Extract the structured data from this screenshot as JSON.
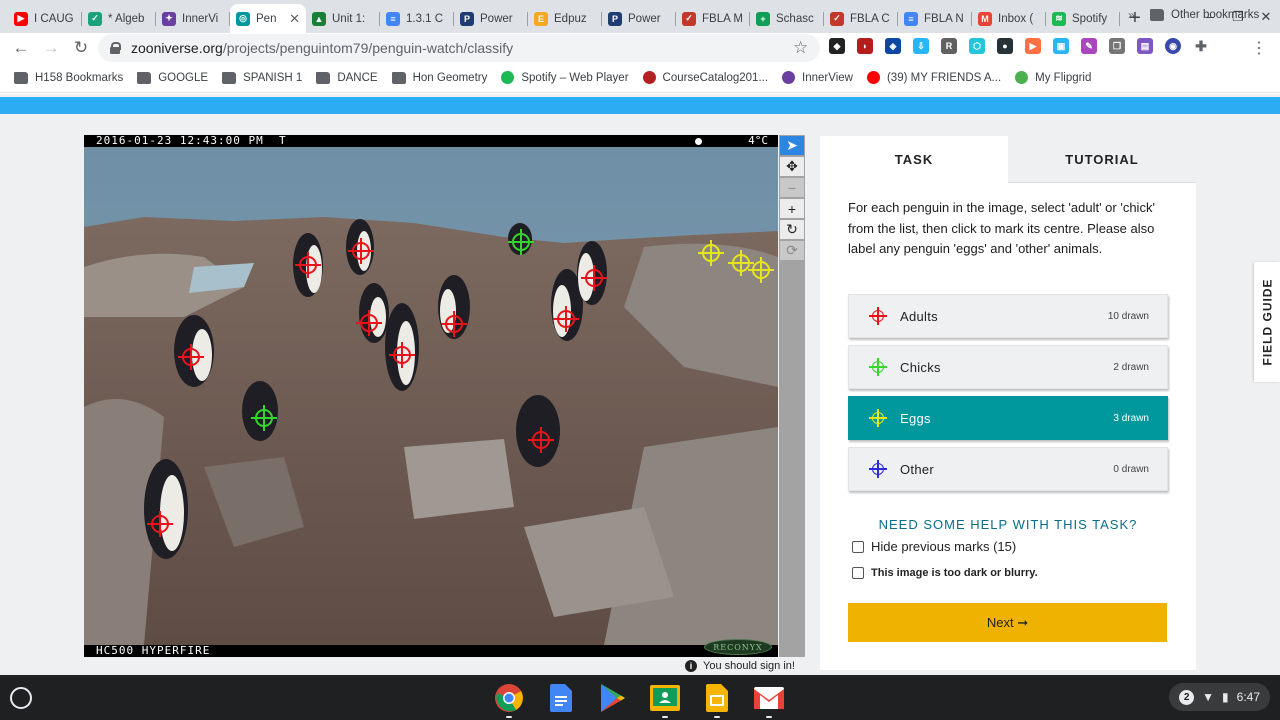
{
  "browser": {
    "tabs": [
      {
        "label": "I CAUG",
        "color": "#ff0000",
        "glyph": "▶"
      },
      {
        "label": "* Algeb",
        "color": "#1aa37a",
        "glyph": "✓"
      },
      {
        "label": "InnerVi",
        "color": "#6a3fa0",
        "glyph": "✦"
      },
      {
        "label": "Pen",
        "color": "#00979d",
        "glyph": "◎",
        "active": true
      },
      {
        "label": "Unit 1:",
        "color": "#188038",
        "glyph": "▲"
      },
      {
        "label": "1.3.1 C",
        "color": "#4285f4",
        "glyph": "≡"
      },
      {
        "label": "Power",
        "color": "#1e3c72",
        "glyph": "P"
      },
      {
        "label": "Edpuz",
        "color": "#f5a623",
        "glyph": "E"
      },
      {
        "label": "Power",
        "color": "#1e3c72",
        "glyph": "P"
      },
      {
        "label": "FBLA M",
        "color": "#c0392b",
        "glyph": "✓"
      },
      {
        "label": "Schasc",
        "color": "#0f9d58",
        "glyph": "+"
      },
      {
        "label": "FBLA C",
        "color": "#c0392b",
        "glyph": "✓"
      },
      {
        "label": "FBLA N",
        "color": "#4285f4",
        "glyph": "≡"
      },
      {
        "label": "Inbox (",
        "color": "#ea4335",
        "glyph": "M"
      },
      {
        "label": "Spotify",
        "color": "#1db954",
        "glyph": "≋"
      }
    ],
    "new_tab_label": "+",
    "window_controls": [
      "–",
      "❐",
      "✕"
    ],
    "url_host": "zooniverse.org",
    "url_path": "/projects/penguintom79/penguin-watch/classify",
    "bookmarks": [
      {
        "label": "H158 Bookmarks",
        "type": "folder"
      },
      {
        "label": "GOOGLE",
        "type": "folder"
      },
      {
        "label": "SPANISH 1",
        "type": "folder"
      },
      {
        "label": "DANCE",
        "type": "folder"
      },
      {
        "label": "Hon Geometry",
        "type": "folder"
      },
      {
        "label": "Spotify – Web Player",
        "type": "site",
        "color": "#1db954"
      },
      {
        "label": "CourseCatalog201...",
        "type": "site",
        "color": "#b22222"
      },
      {
        "label": "InnerView",
        "type": "site",
        "color": "#6a3fa0"
      },
      {
        "label": "(39) MY FRIENDS A...",
        "type": "site",
        "color": "#ff0000"
      },
      {
        "label": "My Flipgrid",
        "type": "site",
        "color": "#4caf50"
      }
    ],
    "bookmarks_more": "»",
    "other_bookmarks": "Other bookmarks"
  },
  "camera": {
    "timestamp": "2016-01-23 12:43:00 PM  T",
    "temperature": "4°C",
    "model": "HC500 HYPERFIRE",
    "brand": "RECONYX"
  },
  "colors": {
    "adult": "#e8141b",
    "chick": "#35d62e",
    "egg": "#e6e61c",
    "other": "#2b2bd9",
    "selected_task": "#00979d",
    "next_button": "#f0b200"
  },
  "panel": {
    "tab_task": "TASK",
    "tab_tutorial": "TUTORIAL",
    "instructions": "For each penguin in the image, select 'adult' or 'chick' from the list, then click to mark its centre. Please also label any penguin 'eggs' and 'other' animals.",
    "answers": [
      {
        "label": "Adults",
        "count": "10 drawn"
      },
      {
        "label": "Chicks",
        "count": "2 drawn"
      },
      {
        "label": "Eggs",
        "count": "3 drawn"
      },
      {
        "label": "Other",
        "count": "0 drawn"
      }
    ],
    "help": "NEED SOME HELP WITH THIS TASK?",
    "hide_marks": "Hide previous marks (15)",
    "too_dark": "This image is too dark or blurry.",
    "next": "Next ➞"
  },
  "sign_in": "You should sign in!",
  "field_guide": "FIELD GUIDE",
  "tray": {
    "notifications": "2",
    "time": "6:47"
  }
}
